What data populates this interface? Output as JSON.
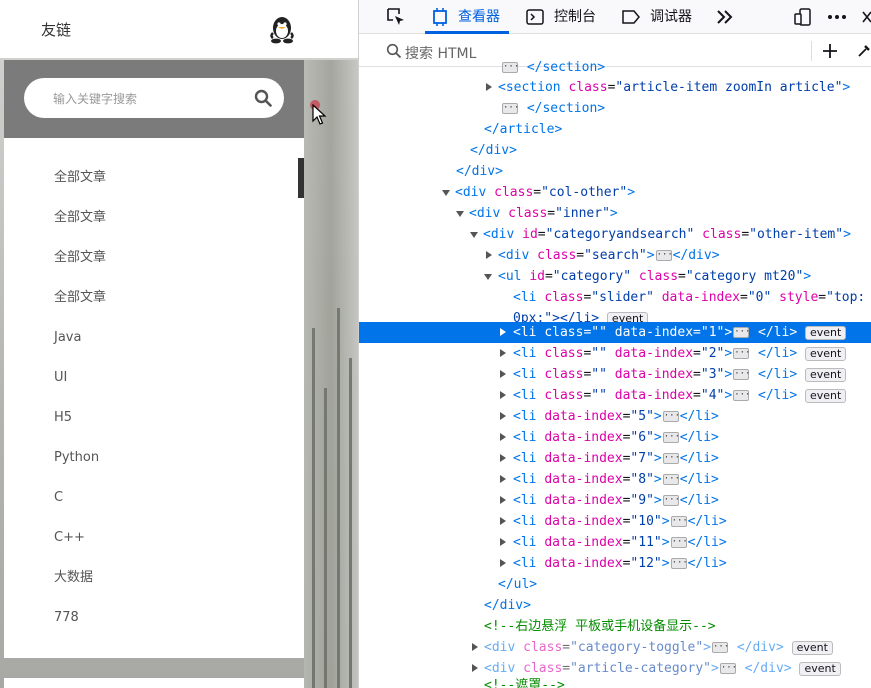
{
  "page": {
    "title": "友链",
    "search_placeholder": "输入关键字搜索",
    "categories": [
      "全部文章",
      "全部文章",
      "全部文章",
      "全部文章",
      "Java",
      "UI",
      "H5",
      "Python",
      "C",
      "C++",
      "大数据",
      "778"
    ]
  },
  "devtools": {
    "tabs": {
      "inspector": "查看器",
      "console": "控制台",
      "debugger": "调试器"
    },
    "search_placeholder": "搜索 HTML",
    "rows": {
      "r0": "</section>",
      "r1_open": "<section ",
      "r1_attr": "class",
      "r1_val": "\"article-item zoomIn article\"",
      "r1_close": ">",
      "r2_close": "</section>",
      "r3": "</article>",
      "r4": "</div>",
      "r5": "</div>",
      "r6_open": "<div ",
      "r6_attr": "class",
      "r6_val": "\"col-other\"",
      "r6_close": ">",
      "r7_open": "<div ",
      "r7_attr": "class",
      "r7_val": "\"inner\"",
      "r7_close": ">",
      "r8_open": "<div ",
      "r8_attr1": "id",
      "r8_val1": "\"categoryandsearch\"",
      "r8_attr2": "class",
      "r8_val2": "\"other-item\"",
      "r8_close": ">",
      "r9_open": "<div ",
      "r9_attr": "class",
      "r9_val": "\"search\"",
      "r9_close": "</div>",
      "r10_open": "<ul ",
      "r10_attr1": "id",
      "r10_val1": "\"category\"",
      "r10_attr2": "class",
      "r10_val2": "\"category mt20\"",
      "r10_close": ">",
      "r11_open": "<li ",
      "r11_attr1": "class",
      "r11_val1": "\"slider\"",
      "r11_attr2": "data-index",
      "r11_val2": "\"0\"",
      "r11_attr3": "style",
      "r11_val3": "\"top:",
      "r12": "0px;\"></li>",
      "li_attr_class": "class",
      "li_val_class": "\"\"",
      "li_attr_index": "data-index",
      "li_close": "</li>",
      "r24": "</ul>",
      "r25": "</div>",
      "r26": "<!--右边悬浮 平板或手机设备显示-->",
      "r27_attr": "class",
      "r27_val": "\"category-toggle\"",
      "r28_attr": "class",
      "r28_val": "\"article-category\"",
      "r29": "<!--遮罩-->",
      "open_li": "<li ",
      "open_div": "<div ",
      "div_end": "</div>",
      "eq": "=",
      "gt": ">",
      "event": "event",
      "idx": [
        "\"1\"",
        "\"2\"",
        "\"3\"",
        "\"4\"",
        "\"5\"",
        "\"6\"",
        "\"7\"",
        "\"8\"",
        "\"9\"",
        "\"10\"",
        "\"11\"",
        "\"12\""
      ]
    }
  }
}
